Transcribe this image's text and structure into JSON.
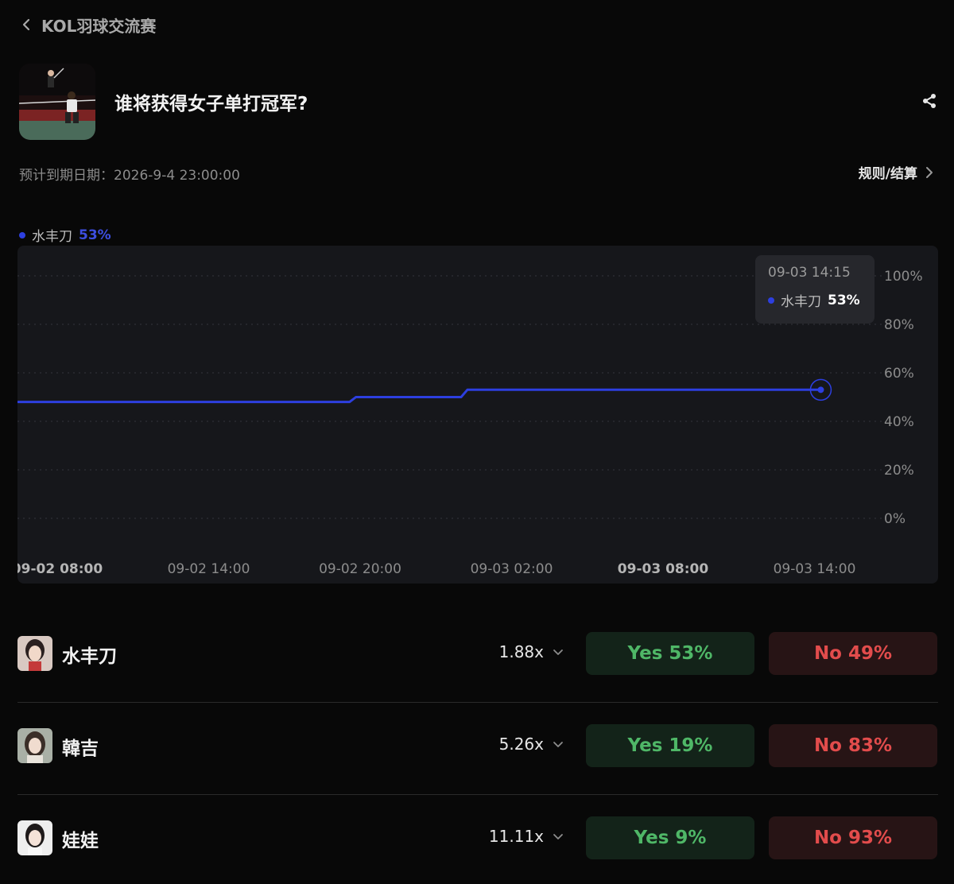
{
  "header": {
    "back_label": "KOL羽球交流赛"
  },
  "market": {
    "title": "谁将获得女子单打冠军?",
    "expiry": "预计到期日期：2026-9-4 23:00:00",
    "rules_label": "规则/结算"
  },
  "colors": {
    "accent": "#2d3fe0",
    "yes_text": "#4fb767",
    "no_text": "#e24c4c",
    "background": "#080808",
    "chart_bg": "#16171b"
  },
  "legend": {
    "name": "水丰刀",
    "value": "53%"
  },
  "tooltip": {
    "time": "09-03 14:15",
    "name": "水丰刀",
    "value": "53%"
  },
  "chart_data": {
    "type": "line",
    "y_ticks": [
      "100%",
      "80%",
      "60%",
      "40%",
      "20%",
      "0%"
    ],
    "x_ticks": [
      "09-02 08:00",
      "09-02 14:00",
      "09-02 20:00",
      "09-03 02:00",
      "09-03 08:00",
      "09-03 14:00"
    ],
    "ylim": [
      0,
      100
    ],
    "grid": true,
    "series": [
      {
        "name": "水丰刀",
        "points": [
          {
            "x": "09-02 08:00",
            "y": 48
          },
          {
            "x": "09-02 19:35",
            "y": 48
          },
          {
            "x": "09-02 19:50",
            "y": 50
          },
          {
            "x": "09-03 00:00",
            "y": 50
          },
          {
            "x": "09-03 00:15",
            "y": 53
          },
          {
            "x": "09-03 14:15",
            "y": 53
          }
        ]
      }
    ]
  },
  "outcomes": [
    {
      "name": "水丰刀",
      "multiplier": "1.88x",
      "yes": "Yes 53%",
      "no": "No 49%"
    },
    {
      "name": "韓吉",
      "multiplier": "5.26x",
      "yes": "Yes 19%",
      "no": "No 83%"
    },
    {
      "name": "娃娃",
      "multiplier": "11.11x",
      "yes": "Yes 9%",
      "no": "No 93%"
    }
  ]
}
